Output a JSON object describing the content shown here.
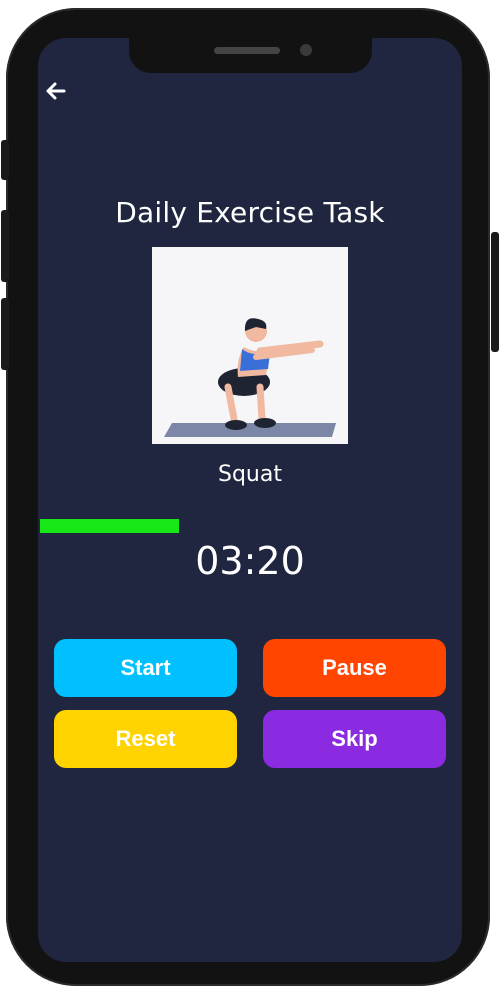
{
  "header": {
    "back_icon": "arrow-left-icon",
    "title": "Daily Exercise Task"
  },
  "exercise": {
    "image_alt": "Woman doing a squat on a yoga mat",
    "name": "Squat"
  },
  "progress": {
    "fraction": 0.33,
    "color": "#17e617"
  },
  "timer": {
    "value": "03:20"
  },
  "controls": {
    "start": {
      "label": "Start",
      "color": "#00c0ff"
    },
    "pause": {
      "label": "Pause",
      "color": "#ff4500"
    },
    "reset": {
      "label": "Reset",
      "color": "#ffd300"
    },
    "skip": {
      "label": "Skip",
      "color": "#8a2be2"
    }
  },
  "theme": {
    "screen_background": "#20263f",
    "phone_frame": "#121212"
  }
}
